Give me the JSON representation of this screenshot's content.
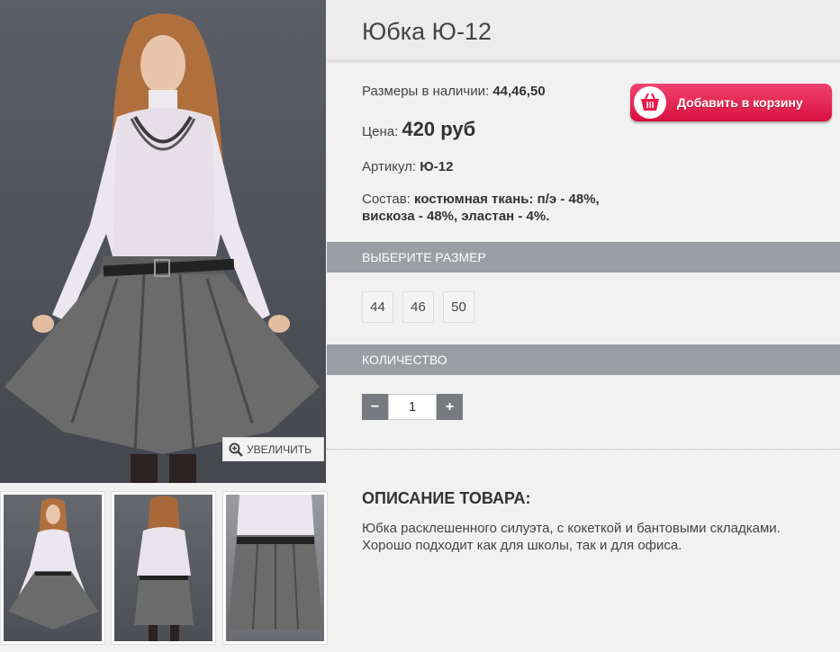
{
  "product": {
    "title": "Юбка Ю-12",
    "sizes_label": "Размеры в наличии:",
    "sizes_value": "44,46,50",
    "price_label": "Цена:",
    "price_value": "420 руб",
    "sku_label": "Артикул:",
    "sku_value": "Ю-12",
    "composition_label": "Состав:",
    "composition_value": "костюмная ткань: п/э - 48%, вискоза - 48%, эластан - 4%."
  },
  "gallery": {
    "zoom_label": "УВЕЛИЧИТЬ",
    "thumbnail_count": 3
  },
  "cart": {
    "button_label": "Добавить в корзину",
    "icon": "shopping-basket-icon",
    "color": "#e5194b"
  },
  "size_section": {
    "heading": "ВЫБЕРИТЕ РАЗМЕР",
    "options": [
      "44",
      "46",
      "50"
    ]
  },
  "quantity_section": {
    "heading": "КОЛИЧЕСТВО",
    "minus": "−",
    "plus": "+",
    "value": "1"
  },
  "description": {
    "heading": "ОПИСАНИЕ ТОВАРА:",
    "text": "Юбка расклешенного силуэта, с кокеткой и бантовыми складками. Хорошо подходит как для школы, так и для офиса."
  },
  "colors": {
    "section_bar": "#9b9ea3",
    "qty_button": "#777a7f",
    "page_bg": "#f1f1f1"
  }
}
